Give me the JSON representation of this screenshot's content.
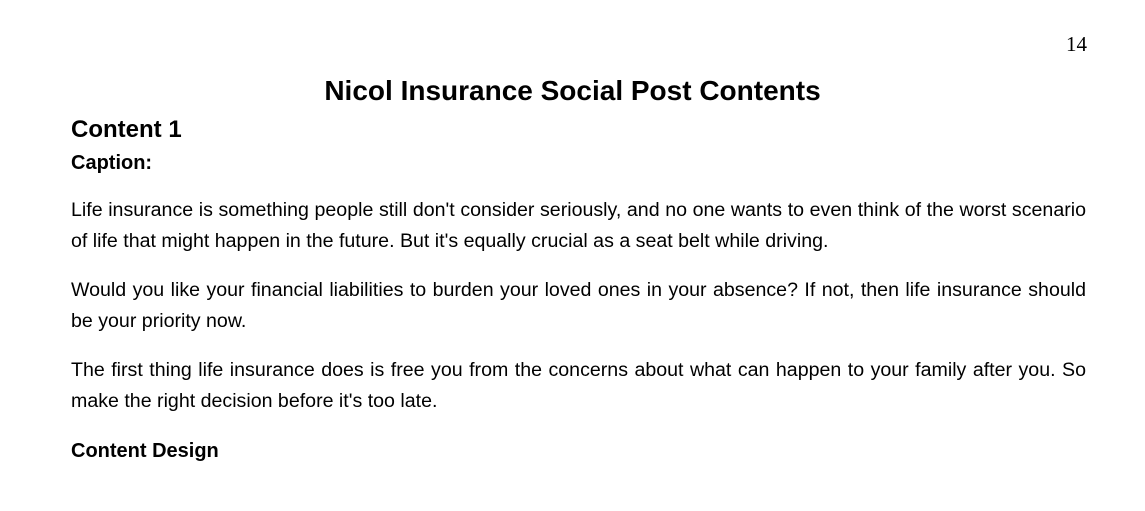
{
  "page": {
    "number": "14",
    "title": "Nicol Insurance Social Post Contents"
  },
  "content": {
    "heading": "Content 1",
    "caption_label": "Caption:",
    "paragraphs": [
      "Life insurance is something people still don't consider seriously, and no one wants to even think of the worst scenario of life that might happen in the future. But it's equally crucial as a seat belt while driving.",
      "Would you like your financial liabilities to burden your loved ones in your absence? If not, then life insurance should be your priority now.",
      "The first thing life insurance does is free you from the concerns about what can happen to your family after you. So make the right decision before it's too late."
    ],
    "design_heading": "Content Design"
  }
}
